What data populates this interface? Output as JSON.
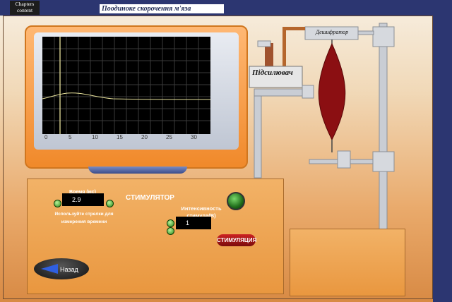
{
  "header": {
    "chapters_label": "Chapters content",
    "title": "Поодиноке скорочення м'яза"
  },
  "oscilloscope": {
    "x_ticks": [
      "0",
      "5",
      "10",
      "15",
      "20",
      "25",
      "30"
    ]
  },
  "apparatus": {
    "amplifier_label": "Підсилювач",
    "transducer_label": "Дешифратор"
  },
  "stimulator": {
    "title": "СТИМУЛЯТОР",
    "time_label": "Время (мс)",
    "time_value": "2.9",
    "hint": "Используйте стрелки для измерения времени",
    "intensity_label": "Интенсивность стимула(В)",
    "intensity_value": "1",
    "stimulate_button": "СТИМУЛЯЦИЯ"
  },
  "nav": {
    "back_label": "Назад"
  },
  "colors": {
    "header": "#2c3671",
    "console": "#e9973f",
    "trace": "#e8e29b",
    "button": "#c22222"
  }
}
